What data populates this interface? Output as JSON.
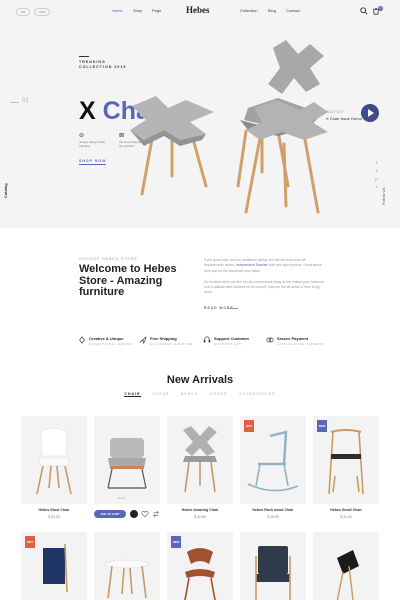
{
  "header": {
    "lang": "EN",
    "currency": "USD",
    "nav": [
      "Home",
      "Shop",
      "Page",
      "Collection",
      "Blog",
      "Contact"
    ],
    "logo": "Hebes",
    "cart_count": "0"
  },
  "hero": {
    "tag": "TRENDING COLLECTION 2019",
    "title_x": "X",
    "title_chair": "Chair",
    "counter": "01",
    "feature1_icon": "⊘",
    "feature1_text": "unique design chair trending",
    "feature2_icon": "⊠",
    "feature2_text": "the best materials for the product",
    "shop_now": "SHOP NOW",
    "side_left": "Catalog",
    "side_right": "Follow Us",
    "watch_label": "WATCH",
    "watch_title": "X Chair Issue Demo",
    "socials": [
      "f",
      "t",
      "p",
      "i"
    ]
  },
  "welcome": {
    "tag": "CHOOSE HEBES STORE",
    "title": "Welcome to Hebes Store - Amazing furniture",
    "text_a": "If you great style and our additional design are like the most your all requirements needs, ",
    "text_highlight": "Independent Teacher",
    "text_b": " with new type product. Great sense here you for the combined your place.",
    "text_c": "So furniture store are like our all current trend today of the hottest your bedroom look a attitude with furniture on its current. Improve the all areas of thee living room.",
    "read_more": "READ MORE"
  },
  "services": [
    {
      "icon": "creative-icon",
      "title": "Creative & Unique",
      "sub": "EXCEPTIONAL DESIGN"
    },
    {
      "icon": "shipping-icon",
      "title": "Free Shipping",
      "sub": "ALL ORDER OVER $99"
    },
    {
      "icon": "support-icon",
      "title": "Support Customer",
      "sub": "SUPPORT 24/7"
    },
    {
      "icon": "payment-icon",
      "title": "Secure Payment",
      "sub": "100% SECURE PAYMENT"
    }
  ],
  "arrivals": {
    "title": "New Arrivals",
    "tabs": [
      "CHAIR",
      "SOFAS",
      "BENCH",
      "DESKS",
      "ACCESSORIES"
    ],
    "add_to_cart": "ADD TO CART",
    "products": [
      {
        "name": "Hebes Stool Chair",
        "price": "$ 32.00",
        "badge": ""
      },
      {
        "name": "",
        "price": "",
        "badge": ""
      },
      {
        "name": "Hebes Amazing Chair",
        "price": "$ 32.00",
        "badge": ""
      },
      {
        "name": "Hebes Rock wood Chair",
        "price": "$ 15.00",
        "badge": "HOT"
      },
      {
        "name": "Hebes Small Chair",
        "price": "$ 32.00",
        "badge": "NEW"
      }
    ],
    "row2_badges": [
      "HOT",
      "",
      "NEW",
      "",
      ""
    ]
  },
  "colors": {
    "accent": "#5a67b8",
    "hot": "#e0603f",
    "hero_bg": "#f4f4f4",
    "card_bg": "#f3f3f3"
  }
}
